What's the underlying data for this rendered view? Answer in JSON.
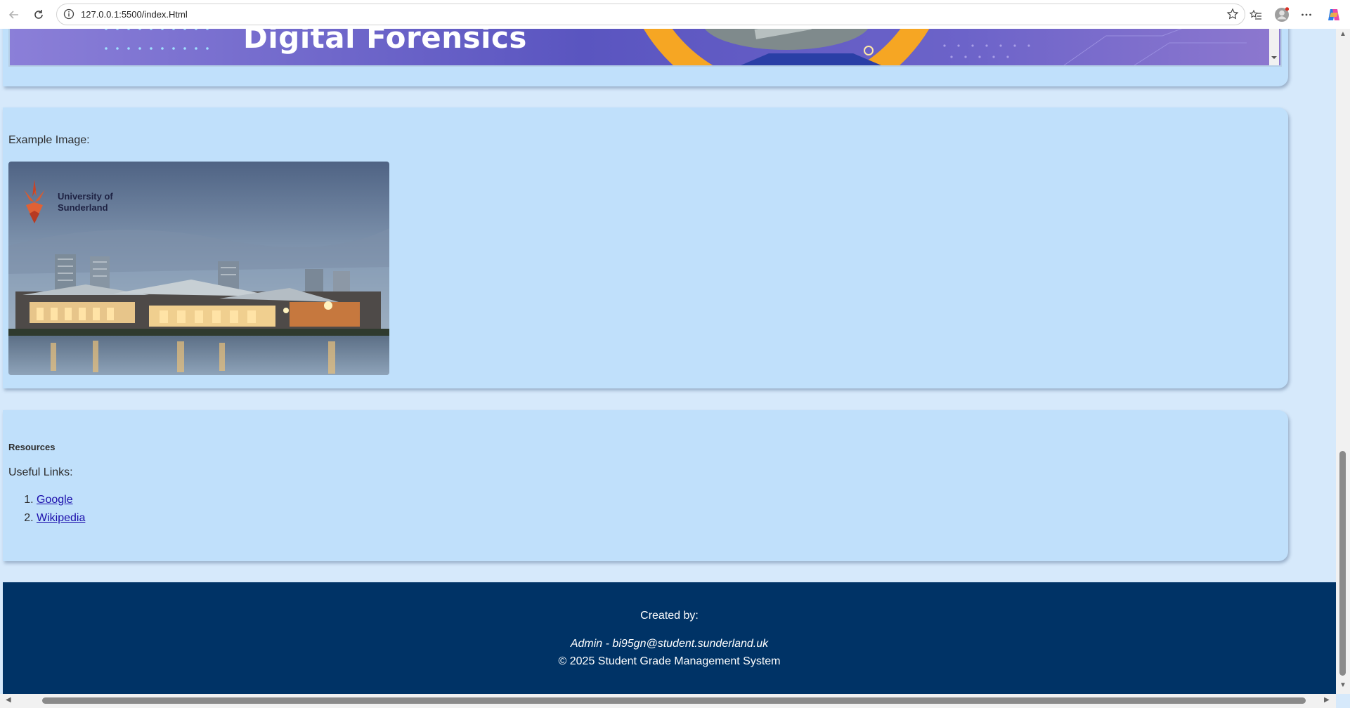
{
  "browser": {
    "url": "127.0.0.1:5500/index.Html"
  },
  "banner": {
    "title": "Digital Forensics"
  },
  "example": {
    "label": "Example Image:",
    "logo_line1": "University of",
    "logo_line2": "Sunderland"
  },
  "resources": {
    "title": "Resources",
    "useful_links_label": "Useful Links:",
    "links": [
      {
        "number": "1.",
        "text": "Google"
      },
      {
        "number": "2.",
        "text": "Wikipedia"
      }
    ]
  },
  "footer": {
    "created_by": "Created by:",
    "admin": "Admin - bi95gn@student.sunderland.uk",
    "copyright": "© 2025 Student Grade Management System"
  },
  "colors": {
    "page_bg": "#d6e9fb",
    "card_bg": "#c0e0fb",
    "footer_bg": "#003366",
    "link": "#1a0dab"
  }
}
